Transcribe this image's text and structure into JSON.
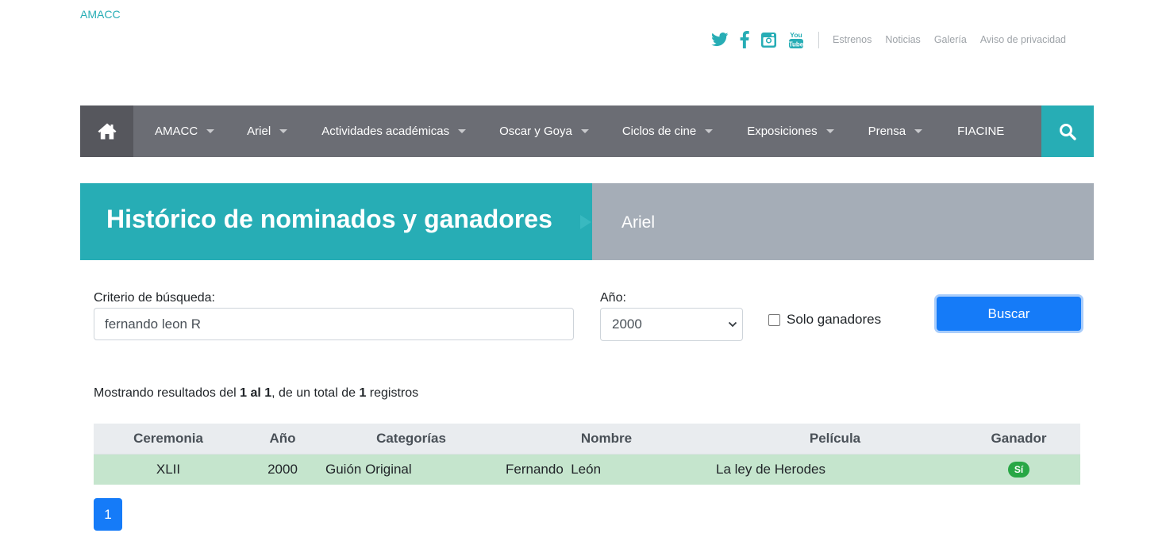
{
  "header": {
    "logo": "AMACC",
    "social": [
      "twitter-icon",
      "facebook-icon",
      "instagram-icon",
      "youtube-icon"
    ],
    "youtube_text": [
      "You",
      "Tube"
    ],
    "links": [
      "Estrenos",
      "Noticias",
      "Galería",
      "Aviso de privacidad"
    ]
  },
  "nav": {
    "items": [
      "AMACC",
      "Ariel",
      "Actividades académicas",
      "Oscar y Goya",
      "Ciclos de cine",
      "Exposiciones",
      "Prensa",
      "FIACINE"
    ],
    "has_dropdown": [
      true,
      true,
      true,
      true,
      true,
      true,
      true,
      false
    ]
  },
  "banner": {
    "title": "Histórico de nominados y ganadores",
    "subtitle": "Ariel"
  },
  "search": {
    "criteria_label": "Criterio de búsqueda:",
    "criteria_value": "fernando leon R",
    "year_label": "Año:",
    "year_value": "2000",
    "winners_only_label": "Solo ganadores",
    "winners_only_checked": false,
    "button_label": "Buscar"
  },
  "results": {
    "prefix": "Mostrando resultados del ",
    "range": "1 al 1",
    "middle": ", de un total de ",
    "total": "1",
    "suffix": " registros"
  },
  "table": {
    "headers": [
      "Ceremonia",
      "Año",
      "Categorías",
      "Nombre",
      "Película",
      "Ganador"
    ],
    "rows": [
      [
        "XLII",
        "2000",
        "Guión Original",
        "Fernando  León",
        "La ley de Herodes",
        "Sí"
      ]
    ]
  },
  "pagination": {
    "current": "1"
  },
  "colors": {
    "teal": "#27adb5",
    "nav_gray": "#6b6d74",
    "banner_gray": "#a5adb7",
    "primary_blue": "#157bf8",
    "row_green": "#c5e5cd",
    "badge_green": "#28a745"
  }
}
